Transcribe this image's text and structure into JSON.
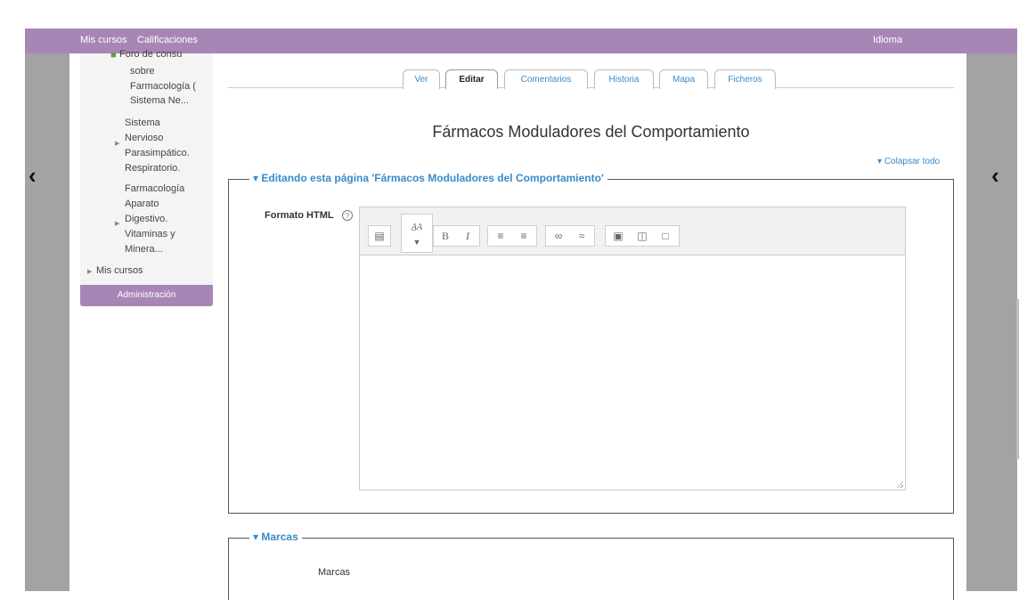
{
  "navbar": {
    "my_courses": "Mis cursos",
    "grades": "Calificaciones",
    "language": "Idioma"
  },
  "sidebar": {
    "items": [
      {
        "lines": [
          "Foro de consu",
          "sobre",
          "Farmacología (",
          "Sistema Ne..."
        ]
      },
      {
        "lines": [
          "Sistema",
          "Nervioso",
          "Parasimpático.",
          "Respiratorio."
        ]
      },
      {
        "lines": [
          "Farmacología",
          "Aparato",
          "Digestivo.",
          "Vitaminas y",
          "Minera..."
        ]
      }
    ],
    "my_courses": "Mis cursos",
    "administration": "Administración"
  },
  "tabs": [
    {
      "label": "Ver",
      "active": false
    },
    {
      "label": "Editar",
      "active": true
    },
    {
      "label": "Comentarios",
      "active": false
    },
    {
      "label": "Historia",
      "active": false
    },
    {
      "label": "Mapa",
      "active": false
    },
    {
      "label": "Ficheros",
      "active": false
    }
  ],
  "page": {
    "title": "Fármacos Moduladores del Comportamiento",
    "collapse_all": "Colapsar todo"
  },
  "edit_section": {
    "legend": "Editando esta página 'Fármacos Moduladores del Comportamiento'",
    "format_label": "Formato HTML",
    "editor_content": ""
  },
  "tags_section": {
    "legend": "Marcas",
    "field_label": "Marcas"
  },
  "colors": {
    "accent_purple": "#a786b6",
    "link_blue": "#3a8bc8",
    "gutter_grey": "#a3a3a3"
  },
  "icons": {
    "chevron_left": "chevron-left-icon",
    "toolbar": [
      "collapse-icon",
      "font-style-icon",
      "bold-icon",
      "italic-icon",
      "unordered-list-icon",
      "ordered-list-icon",
      "link-icon",
      "unlink-icon",
      "image-icon",
      "media-icon",
      "manage-files-icon"
    ]
  }
}
